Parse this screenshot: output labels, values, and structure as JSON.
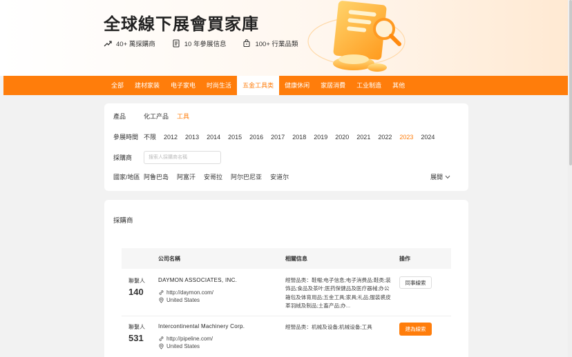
{
  "header": {
    "title": "全球線下展會買家庫",
    "stats": [
      {
        "icon": "trend-up-icon",
        "label": "40+ 萬採購商"
      },
      {
        "icon": "document-icon",
        "label": "10 年參展信息"
      },
      {
        "icon": "bag-icon",
        "label": "100+ 行業品類"
      }
    ]
  },
  "nav": {
    "tabs": [
      "全部",
      "建材家装",
      "电子家电",
      "时尚生活",
      "五金工具类",
      "健康休闲",
      "家居消費",
      "工业制造",
      "其他"
    ],
    "active": "五金工具类"
  },
  "filters": {
    "product": {
      "label": "產品",
      "options": [
        "化工产品",
        "工具"
      ],
      "selected": "工具"
    },
    "time": {
      "label": "參展時間",
      "options": [
        "不限",
        "2012",
        "2013",
        "2014",
        "2015",
        "2016",
        "2017",
        "2018",
        "2019",
        "2020",
        "2021",
        "2022",
        "2023",
        "2024"
      ],
      "selected": "2023"
    },
    "buyer": {
      "label": "採購商",
      "placeholder": "搜索人採購商名稱"
    },
    "region": {
      "label": "國家/地區",
      "options": [
        "阿鲁巴岛",
        "阿富汗",
        "安哥拉",
        "阿尔巴尼亚",
        "安道尔"
      ],
      "expand_label": "展開"
    }
  },
  "list": {
    "title": "採購商",
    "columns": {
      "company": "公司名稱",
      "info": "相關信息",
      "action": "操作"
    },
    "rows": [
      {
        "contacts_label": "聯繫人",
        "contacts": "140",
        "company": "DAYMON ASSOCIATES, INC.",
        "url": "http://daymon.com/",
        "country": "United States",
        "info": "經營品类：鞋帽;电子信息;电子消费品;鞋类;装饰品;食品及茶叶;医药保健品及医疗器械;办公箱包及体育用品;五金工具;家具;礼品;服装裘皮革羽絨及制品;土畜产品;办...",
        "action": "同事線索",
        "action_style": "outline"
      },
      {
        "contacts_label": "聯繫人",
        "contacts": "531",
        "company": "Intercontinental Machinery Corp.",
        "url": "http://pipeline.com/",
        "country": "United States",
        "info": "經營品类：机械及设备;机械设备;工具",
        "action": "建為線索",
        "action_style": "primary"
      }
    ]
  },
  "colors": {
    "accent": "#ff7d0b",
    "background": "#f2f2f2"
  }
}
